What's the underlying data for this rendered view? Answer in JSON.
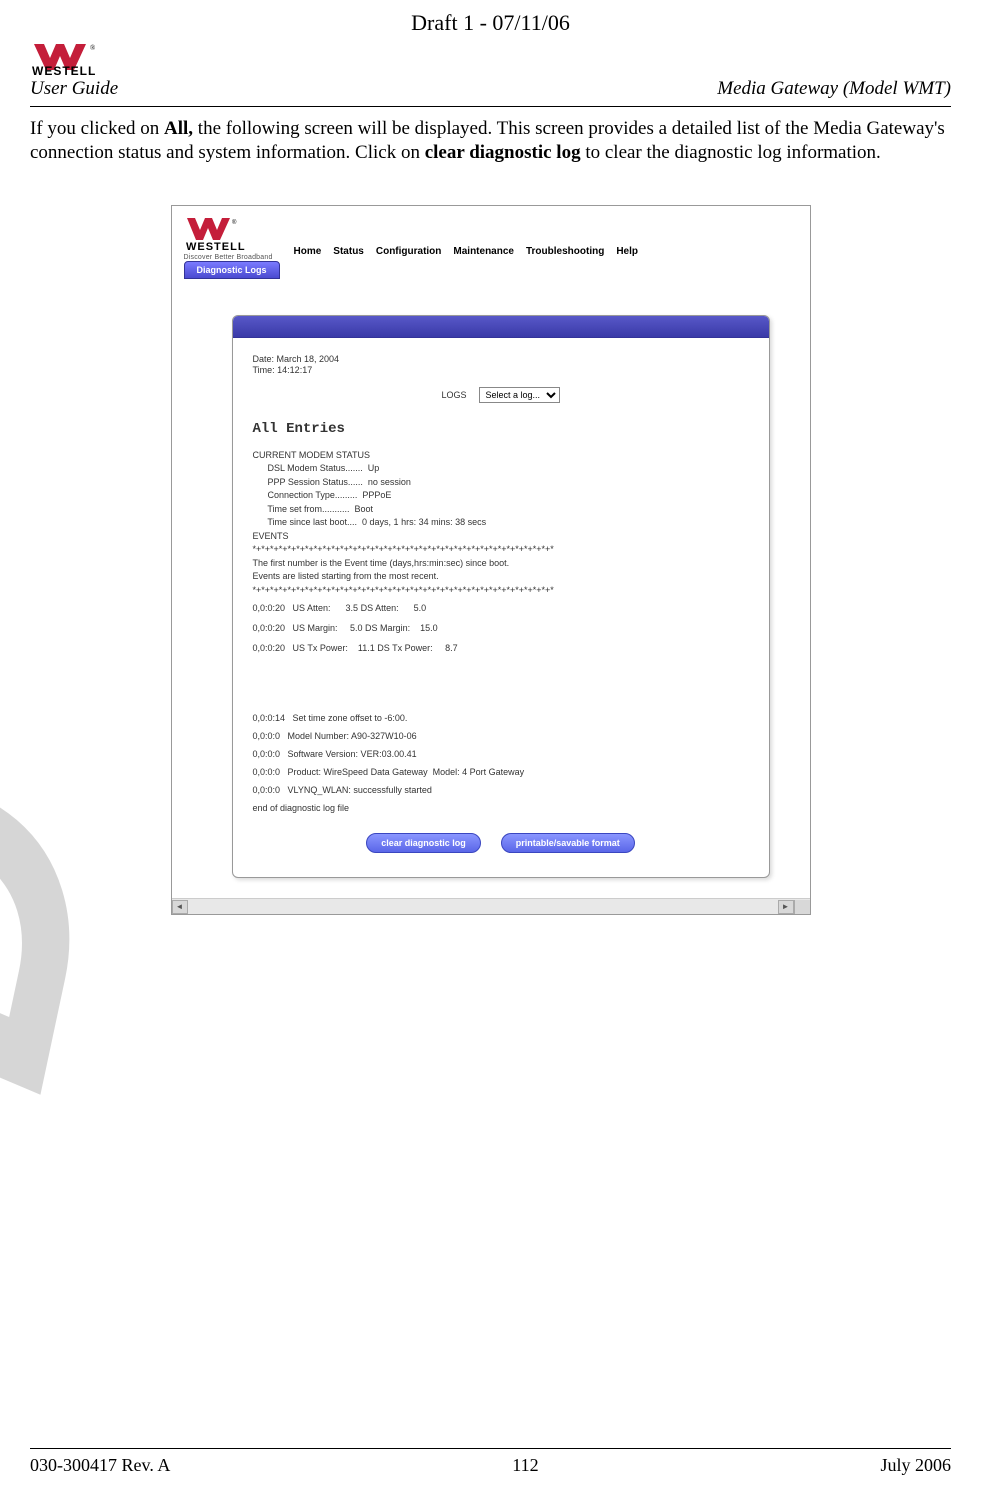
{
  "draft_header": "Draft 1 - 07/11/06",
  "header": {
    "user_guide": "User Guide",
    "doc_title": "Media Gateway (Model WMT)"
  },
  "intro": {
    "pre_all": "If you clicked on ",
    "all": "All,",
    "mid": " the following screen will be displayed. This screen provides a detailed list of the Media Gateway's connection status and system information. Click on ",
    "clear": "clear diagnostic log",
    "post": " to clear the diagnostic log information."
  },
  "screenshot": {
    "logo_text": "WESTELL",
    "tagline": "Discover Better Broadband",
    "menu": [
      "Home",
      "Status",
      "Configuration",
      "Maintenance",
      "Troubleshooting",
      "Help"
    ],
    "tab": "Diagnostic Logs",
    "date_label": "Date: March 18, 2004",
    "time_label": "Time: 14:12:17",
    "logs_label": "LOGS",
    "logs_select": "Select a log...",
    "all_entries": "All Entries",
    "status_title": "CURRENT MODEM STATUS",
    "status_lines": [
      "      DSL Modem Status.......  Up",
      "      PPP Session Status......  no session",
      "      Connection Type.........  PPPoE",
      "      Time set from...........  Boot",
      "      Time since last boot....  0 days, 1 hrs: 34 mins: 38 secs"
    ],
    "events_title": "EVENTS",
    "divider": "*+*+*+*+*+*+*+*+*+*+*+*+*+*+*+*+*+*+*+*+*+*+*+*+*+*+*+*+*+*+*+*+*+*+*",
    "events_desc1": "The first number is the Event time (days,hrs:min:sec) since boot.",
    "events_desc2": "Events are listed starting from the most recent.",
    "event_rows_top": [
      "0,0:0:20   US Atten:      3.5 DS Atten:      5.0",
      "0,0:0:20   US Margin:     5.0 DS Margin:    15.0",
      "0,0:0:20   US Tx Power:    11.1 DS Tx Power:     8.7"
    ],
    "event_rows_bottom": [
      "0,0:0:14   Set time zone offset to -6:00.",
      "0,0:0:0   Model Number: A90-327W10-06",
      "0,0:0:0   Software Version: VER:03.00.41",
      "0,0:0:0   Product: WireSpeed Data Gateway  Model: 4 Port Gateway",
      "0,0:0:0   VLYNQ_WLAN: successfully started"
    ],
    "end_line": "end of diagnostic log file",
    "buttons": {
      "clear": "clear diagnostic log",
      "printable": "printable/savable format"
    }
  },
  "footer": {
    "left": "030-300417 Rev. A",
    "center": "112",
    "right": "July 2006"
  }
}
